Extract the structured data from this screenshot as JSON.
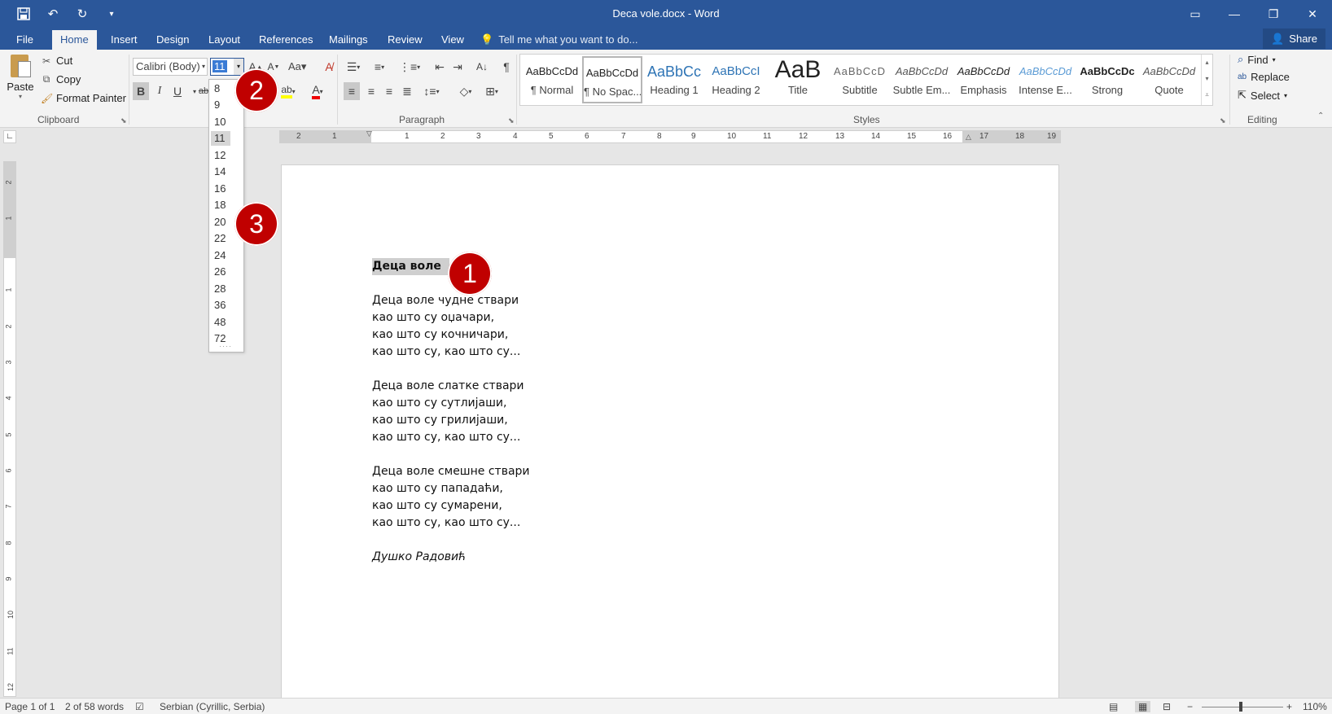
{
  "window": {
    "title": "Deca vole.docx - Word"
  },
  "qat": {
    "save": "save-icon",
    "undo": "undo-icon",
    "redo": "redo-icon",
    "customize": "▾"
  },
  "tabs": [
    "File",
    "Home",
    "Insert",
    "Design",
    "Layout",
    "References",
    "Mailings",
    "Review",
    "View"
  ],
  "tellme": "Tell me what you want to do...",
  "share": "Share",
  "clipboard": {
    "paste": "Paste",
    "cut": "Cut",
    "copy": "Copy",
    "format_painter": "Format Painter",
    "label": "Clipboard"
  },
  "font": {
    "name": "Calibri (Body)",
    "size": "11",
    "label": ""
  },
  "paragraph": {
    "label": "Paragraph"
  },
  "styles": {
    "label": "Styles",
    "items": [
      {
        "sample": "AaBbCcDd",
        "name": "¶ Normal"
      },
      {
        "sample": "AaBbCcDd",
        "name": "¶ No Spac..."
      },
      {
        "sample": "AaBbCc",
        "name": "Heading 1"
      },
      {
        "sample": "AaBbCcI",
        "name": "Heading 2"
      },
      {
        "sample": "AaB",
        "name": "Title"
      },
      {
        "sample": "AaBbCcD",
        "name": "Subtitle"
      },
      {
        "sample": "AaBbCcDd",
        "name": "Subtle Em..."
      },
      {
        "sample": "AaBbCcDd",
        "name": "Emphasis"
      },
      {
        "sample": "AaBbCcDd",
        "name": "Intense E..."
      },
      {
        "sample": "AaBbCcDc",
        "name": "Strong"
      },
      {
        "sample": "AaBbCcDd",
        "name": "Quote"
      }
    ]
  },
  "editing": {
    "find": "Find",
    "replace": "Replace",
    "select": "Select",
    "label": "Editing"
  },
  "font_sizes": [
    "8",
    "9",
    "10",
    "11",
    "12",
    "14",
    "16",
    "18",
    "20",
    "22",
    "24",
    "26",
    "28",
    "36",
    "48",
    "72"
  ],
  "ruler": {
    "h_ticks": [
      "2",
      "1",
      "1",
      "2",
      "3",
      "4",
      "5",
      "6",
      "7",
      "8",
      "9",
      "10",
      "11",
      "12",
      "13",
      "14",
      "15",
      "16",
      "17",
      "18",
      "19"
    ],
    "v_ticks": [
      "2",
      "1",
      "1",
      "2",
      "3",
      "4",
      "5",
      "6",
      "7",
      "8",
      "9",
      "10",
      "11",
      "12"
    ]
  },
  "document": {
    "title": "Деца воле",
    "stanzas": [
      [
        "Деца воле чудне ствари",
        "као што су оџачари,",
        "као што су кочничари,",
        "као што су, као што су..."
      ],
      [
        "Деца воле слатке ствари",
        "као што су сутлијаши,",
        "као што су грилијаши,",
        "као што су, као што су..."
      ],
      [
        "Деца воле смешне ствари",
        "као што су пападаћи,",
        "као што су сумарени,",
        "као што су, као што су..."
      ]
    ],
    "author": "Душко Радовић"
  },
  "callouts": [
    "1",
    "2",
    "3"
  ],
  "status": {
    "page": "Page 1 of 1",
    "words": "2 of 58 words",
    "language": "Serbian (Cyrillic, Serbia)",
    "zoom": "110%"
  }
}
